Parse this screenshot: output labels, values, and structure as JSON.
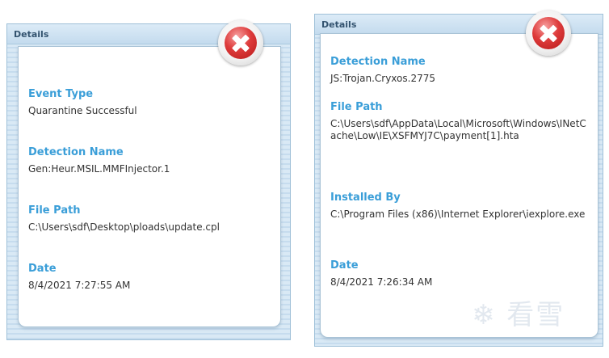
{
  "left_panel": {
    "title": "Details",
    "fields": [
      {
        "label": "Event Type",
        "value": "Quarantine Successful"
      },
      {
        "label": "Detection Name",
        "value": "Gen:Heur.MSIL.MMFInjector.1"
      },
      {
        "label": "File Path",
        "value": "C:\\Users\\sdf\\Desktop\\ploads\\update.cpl"
      },
      {
        "label": "Date",
        "value": "8/4/2021 7:27:55 AM"
      }
    ]
  },
  "right_panel": {
    "title": "Details",
    "fields": [
      {
        "label": "Detection Name",
        "value": "JS:Trojan.Cryxos.2775"
      },
      {
        "label": "File Path",
        "value": "C:\\Users\\sdf\\AppData\\Local\\Microsoft\\Windows\\INetCache\\Low\\IE\\XSFMYJ7C\\payment[1].hta"
      },
      {
        "label": "Installed By",
        "value": "C:\\Program Files (x86)\\Internet Explorer\\iexplore.exe"
      },
      {
        "label": "Date",
        "value": "8/4/2021 7:26:34 AM"
      }
    ]
  },
  "watermark": "❄ 看雪",
  "colors": {
    "label": "#3a9ed8",
    "close_red": "#de3b3b",
    "panel_bg": "#d9e9f5"
  },
  "icons": {
    "close": "close-icon"
  }
}
